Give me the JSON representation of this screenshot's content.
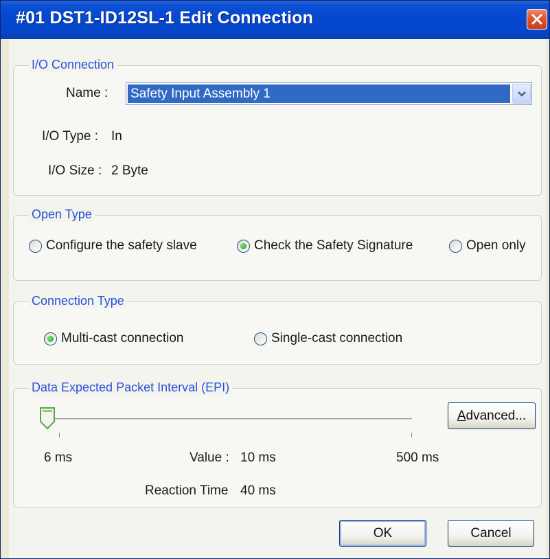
{
  "window": {
    "title": "#01 DST1-ID12SL-1 Edit Connection"
  },
  "io_connection": {
    "legend": "I/O Connection",
    "name_label": "Name :",
    "name_value": "Safety Input Assembly 1",
    "io_type_label": "I/O Type :",
    "io_type_value": "In",
    "io_size_label": "I/O Size :",
    "io_size_value": "2 Byte"
  },
  "open_type": {
    "legend": "Open Type",
    "options": [
      {
        "label": "Configure the safety slave",
        "selected": false
      },
      {
        "label": "Check the Safety Signature",
        "selected": true
      },
      {
        "label": "Open only",
        "selected": false
      }
    ]
  },
  "connection_type": {
    "legend": "Connection Type",
    "options": [
      {
        "label": "Multi-cast connection",
        "selected": true
      },
      {
        "label": "Single-cast connection",
        "selected": false
      }
    ]
  },
  "epi": {
    "legend": "Data Expected Packet Interval (EPI)",
    "min_label": "6 ms",
    "max_label": "500 ms",
    "value_label": "Value :",
    "value": "10 ms",
    "reaction_label": "Reaction Time",
    "reaction_value": "40 ms",
    "advanced_mnemonic": "A",
    "advanced_rest": "dvanced...",
    "slider_fraction": 0.008
  },
  "buttons": {
    "ok": "OK",
    "cancel": "Cancel"
  },
  "colors": {
    "title_bar": "#0548d0",
    "legend_text": "#2850d8",
    "selection": "#316ac5",
    "close": "#e0532c"
  }
}
